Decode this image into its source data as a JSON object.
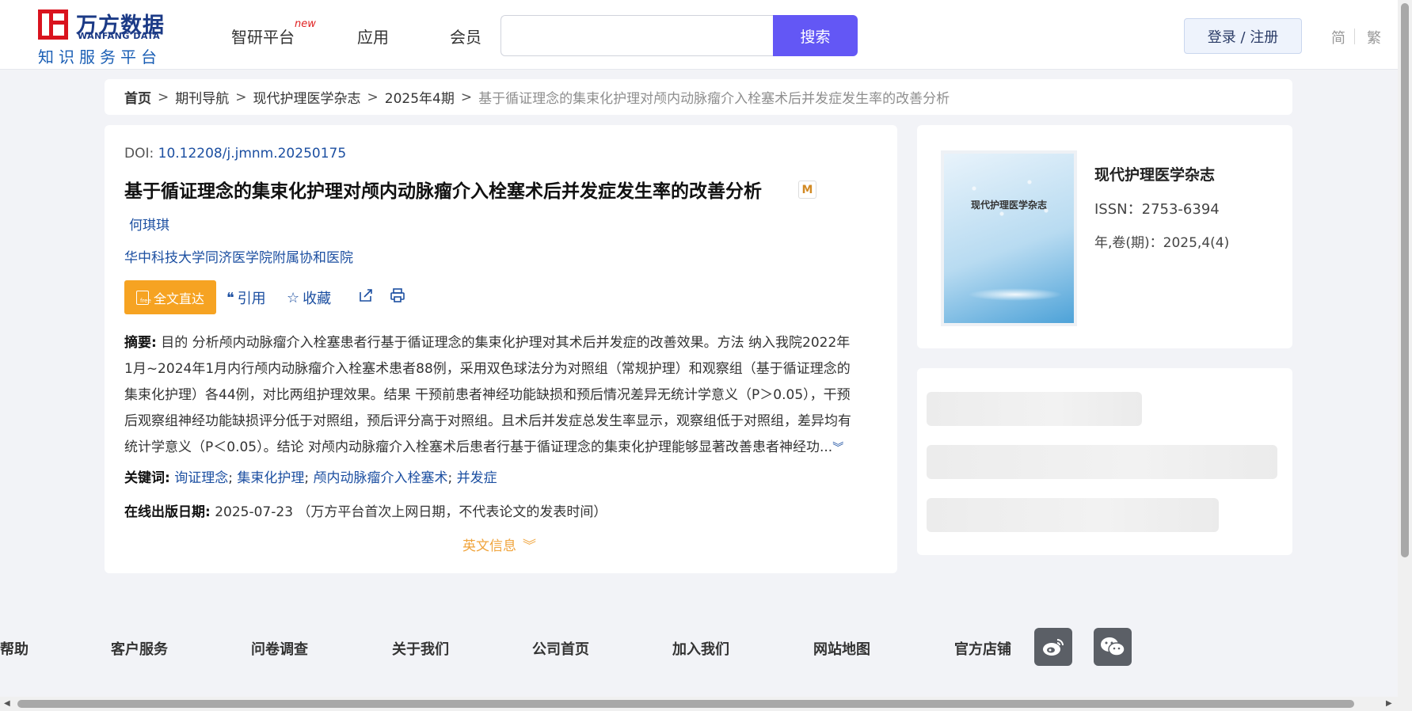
{
  "header": {
    "logo_cn": "万方数据",
    "logo_en": "WANFANG DATA",
    "logo_sub": "知识服务平台",
    "nav": [
      {
        "label": "智研平台",
        "badge": "new"
      },
      {
        "label": "应用"
      },
      {
        "label": "会员"
      }
    ],
    "search_placeholder": "",
    "search_label": "搜索",
    "login_label": "登录 / 注册",
    "lang_simplified": "简",
    "lang_traditional": "繁"
  },
  "breadcrumb": {
    "home": "首页",
    "items": [
      "期刊导航",
      "现代护理医学杂志",
      "2025年4期"
    ],
    "current": "基于循证理念的集束化护理对颅内动脉瘤介入栓塞术后并发症发生率的改善分析",
    "separator": ">"
  },
  "article": {
    "doi_label": "DOI:",
    "doi": "10.12208/j.jmnm.20250175",
    "title": "基于循证理念的集束化护理对颅内动脉瘤介入栓塞术后并发症发生率的改善分析",
    "badge": "M",
    "author": "何琪琪",
    "affiliation": "华中科技大学同济医学院附属协和医院",
    "fulltext_label": "全文直达",
    "actions": {
      "cite": "引用",
      "favorite": "收藏"
    },
    "abstract_label": "摘要:",
    "abstract_lines": [
      "目的 分析颅内动脉瘤介入栓塞患者行基于循证理念的集束化护理对其术后并发症的改善效果。方法 纳入我院2022年",
      "1月~2024年1月内行颅内动脉瘤介入栓塞术患者88例，采用双色球法分为对照组（常规护理）和观察组（基于循证理念的",
      "集束化护理）各44例，对比两组护理效果。结果 干预前患者神经功能缺损和预后情况差异无统计学意义（P＞0.05），干预",
      "后观察组神经功能缺损评分低于对照组，预后评分高于对照组。且术后并发症总发生率显示，观察组低于对照组，差异均有",
      "统计学意义（P＜0.05）。结论 对颅内动脉瘤介入栓塞术后患者行基于循证理念的集束化护理能够显著改善患者神经功..."
    ],
    "keywords_label": "关键词:",
    "keywords": [
      "询证理念",
      "集束化护理",
      "颅内动脉瘤介入栓塞术",
      "并发症"
    ],
    "pubdate_label": "在线出版日期:",
    "pubdate": "2025-07-23",
    "pubdate_note": "（万方平台首次上网日期，不代表论文的发表时间）",
    "en_info_label": "英文信息"
  },
  "journal": {
    "cover_title": "现代护理医学杂志",
    "name": "现代护理医学杂志",
    "issn": "ISSN：2753-6394",
    "volume": "年,卷(期)：2025,4(4)"
  },
  "footer": {
    "links": [
      "帮助",
      "客户服务",
      "问卷调查",
      "关于我们",
      "公司首页",
      "加入我们",
      "网站地图",
      "官方店铺"
    ]
  },
  "colors": {
    "accent": "#6357f5",
    "link": "#1c4fa1",
    "fulltext": "#f6a322",
    "en_info": "#f0a43c",
    "logo_red": "#d9131e"
  }
}
